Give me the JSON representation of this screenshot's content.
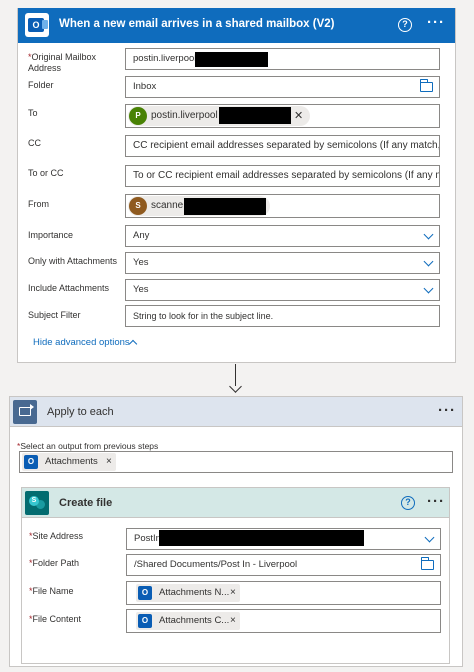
{
  "trigger": {
    "title": "When a new email arrives in a shared mailbox (V2)",
    "icon": "outlook-icon",
    "help_symbol": "?",
    "more_symbol": "···",
    "accent": "#0f6cbd",
    "fields": {
      "mailbox": {
        "required": "*",
        "label": "Original Mailbox Address",
        "value": "postin.liverpool"
      },
      "folder": {
        "label": "Folder",
        "value": "Inbox"
      },
      "to": {
        "label": "To",
        "token_initial": "P",
        "token_text": "postin.liverpool",
        "remove": "✕"
      },
      "cc": {
        "label": "CC",
        "placeholder": "CC recipient email addresses separated by semicolons (If any match, t"
      },
      "to_or_cc": {
        "label": "To or CC",
        "placeholder": "To or CC recipient email addresses separated by semicolons (If any m"
      },
      "from": {
        "label": "From",
        "token_initial": "S",
        "token_text": "scanne",
        "remove": "✕"
      },
      "importance": {
        "label": "Importance",
        "value": "Any"
      },
      "only_attachments": {
        "label": "Only with Attachments",
        "value": "Yes"
      },
      "include_attachments": {
        "label": "Include Attachments",
        "value": "Yes"
      },
      "subject_filter": {
        "label": "Subject Filter",
        "placeholder": "String to look for in the subject line."
      }
    },
    "hide_advanced": "Hide advanced options"
  },
  "apply_each": {
    "title": "Apply to each",
    "more_symbol": "···",
    "select_label_req": "*",
    "select_label": "Select an output from previous steps",
    "chip_text": "Attachments",
    "chip_remove": "×"
  },
  "create_file": {
    "title": "Create file",
    "help_symbol": "?",
    "more_symbol": "···",
    "fields": {
      "site": {
        "required": "*",
        "label": "Site Address",
        "value": "PostIn"
      },
      "folder_path": {
        "required": "*",
        "label": "Folder Path",
        "value": "/Shared Documents/Post In - Liverpool"
      },
      "file_name": {
        "required": "*",
        "label": "File Name",
        "chip_text": "Attachments N...",
        "remove": "×"
      },
      "file_content": {
        "required": "*",
        "label": "File Content",
        "chip_text": "Attachments C...",
        "remove": "×"
      }
    }
  }
}
